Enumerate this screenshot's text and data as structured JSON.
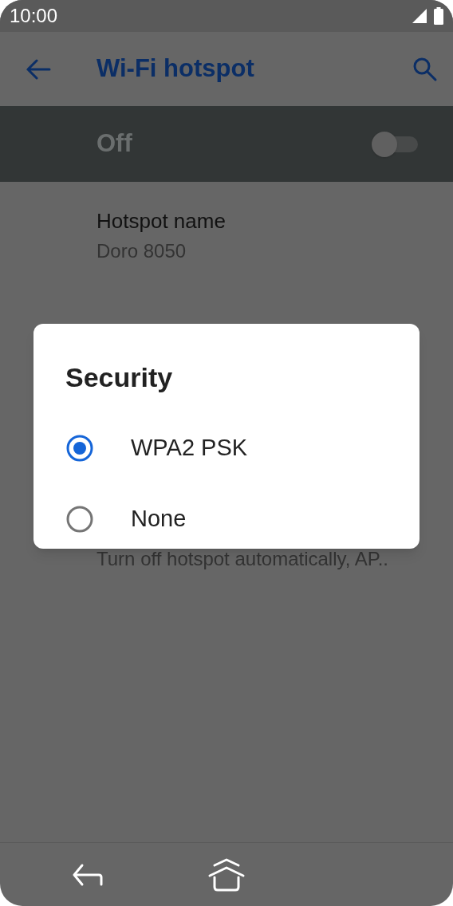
{
  "status_bar": {
    "time": "10:00"
  },
  "toolbar": {
    "title": "Wi-Fi hotspot"
  },
  "master_switch": {
    "label": "Off",
    "on": false
  },
  "settings": [
    {
      "title": "Hotspot name",
      "summary": "Doro 8050"
    },
    {
      "summary": "Turn off hotspot automatically, AP.."
    }
  ],
  "dialog": {
    "title": "Security",
    "options": [
      {
        "label": "WPA2 PSK",
        "selected": true
      },
      {
        "label": "None",
        "selected": false
      }
    ]
  }
}
